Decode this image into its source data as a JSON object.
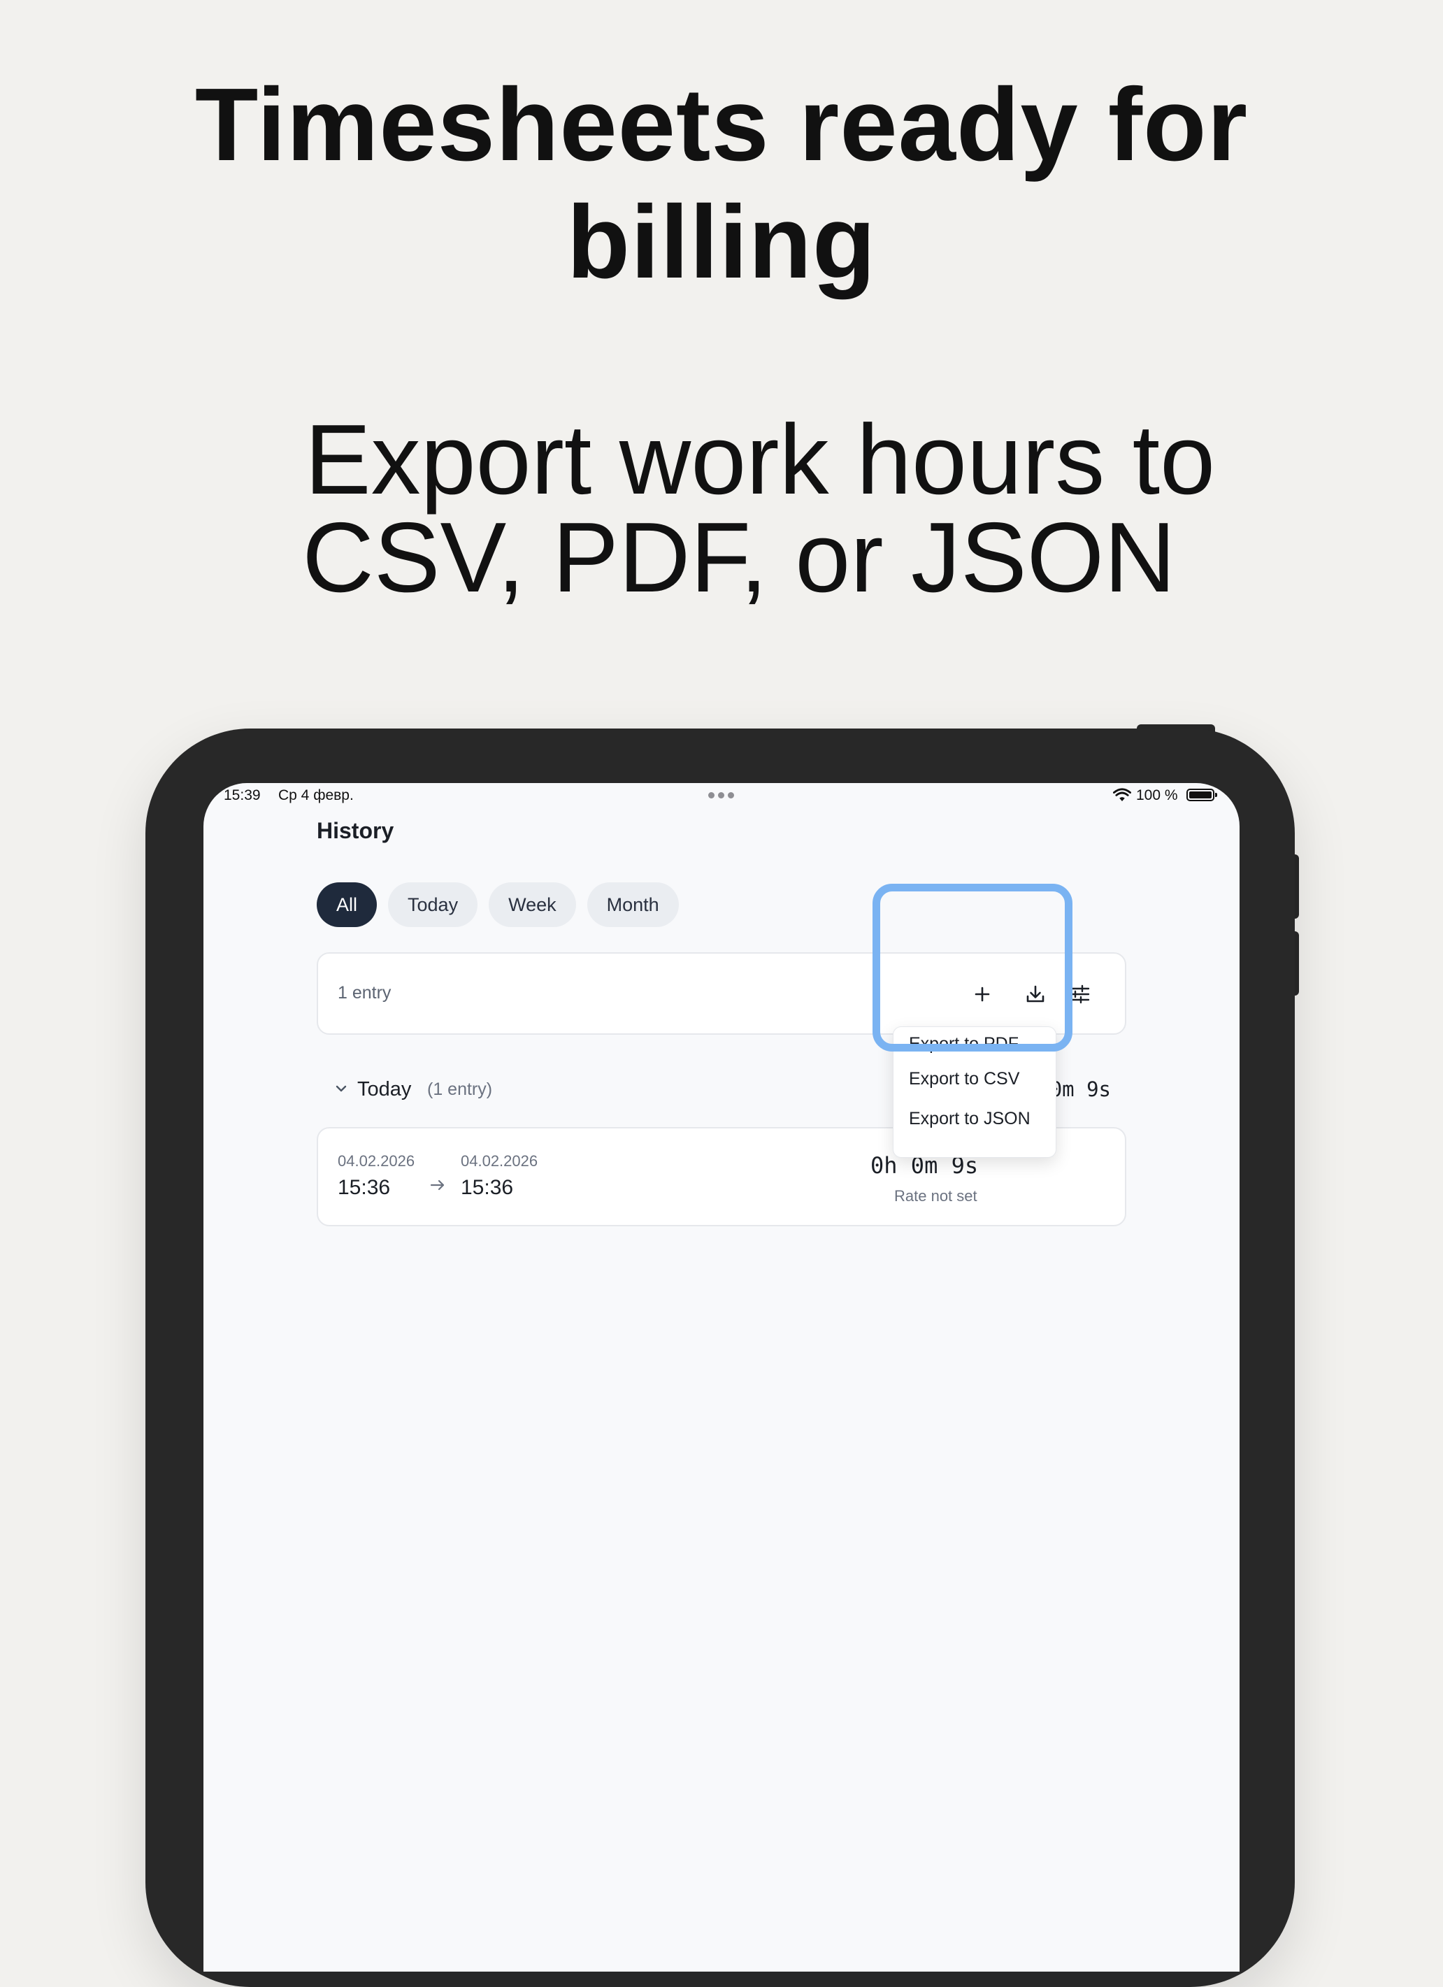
{
  "marketing": {
    "headline_line1": "Timesheets ready for",
    "headline_line2": "billing",
    "subhead_line1": "Export work hours to",
    "subhead_line2": "CSV, PDF, or JSON"
  },
  "status_bar": {
    "time": "15:39",
    "date": "Ср 4 февр.",
    "battery_percent": "100 %"
  },
  "history": {
    "title": "History",
    "filters": [
      {
        "label": "All",
        "active": true
      },
      {
        "label": "Today",
        "active": false
      },
      {
        "label": "Week",
        "active": false
      },
      {
        "label": "Month",
        "active": false
      }
    ],
    "toolbar": {
      "entry_count": "1 entry",
      "icons": [
        "plus-icon",
        "download-icon",
        "sliders-icon"
      ]
    },
    "export_menu": {
      "items": [
        "Export to PDF",
        "Export to CSV",
        "Export to JSON"
      ]
    },
    "group": {
      "title": "Today",
      "count": "(1 entry)",
      "total": "0h 0m 9s"
    },
    "entries": [
      {
        "start_date": "04.02.2026",
        "start_time": "15:36",
        "end_date": "04.02.2026",
        "end_time": "15:36",
        "duration": "0h 0m 9s",
        "rate": "Rate not set"
      }
    ]
  },
  "colors": {
    "background": "#f2f1ee",
    "device": "#282828",
    "screen": "#f8f9fb",
    "active_chip": "#1f2a3c",
    "highlight": "#7ab3f2"
  }
}
